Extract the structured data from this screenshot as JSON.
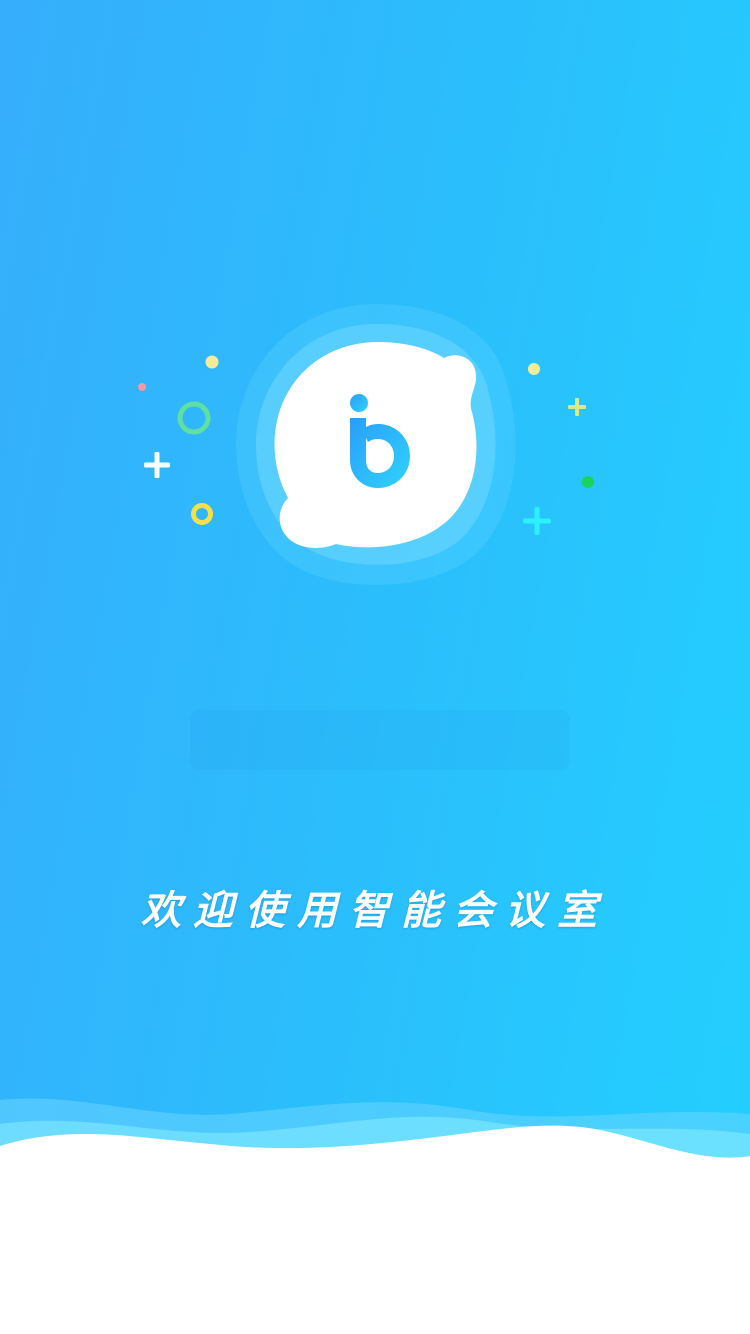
{
  "splash": {
    "welcome_text": "欢迎使用智能会议室"
  },
  "colors": {
    "background_start": "#36aefb",
    "background_end": "#22d0ff",
    "logo_fill": "#ffffff",
    "logo_glyph": "#2aaef6",
    "accent_green": "#5fe0a0",
    "accent_yellow": "#f6e04a",
    "accent_pink": "#f29aa8",
    "accent_cyan": "#2df0ff"
  },
  "icons": {
    "logo": "app-logo-icon",
    "decorations": [
      "plus-icon",
      "ring-icon",
      "dot-icon"
    ]
  }
}
